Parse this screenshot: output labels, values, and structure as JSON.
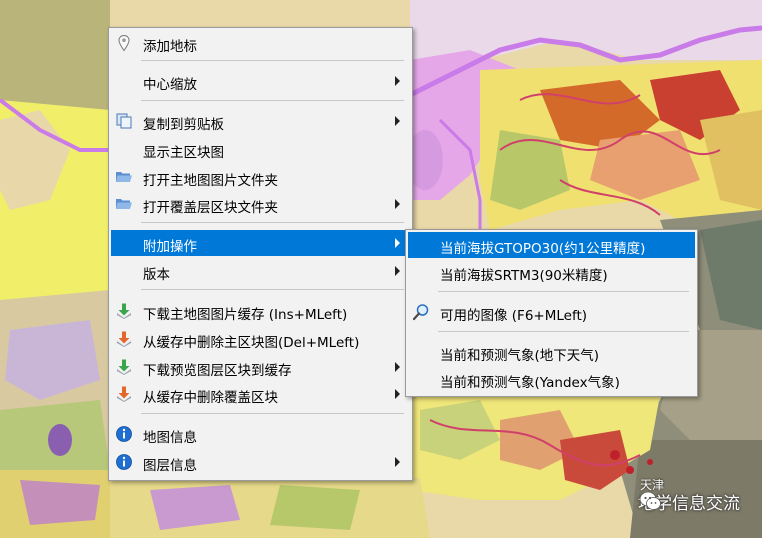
{
  "context_menu": {
    "items": [
      {
        "label": "添加地标",
        "icon": "map-pin-icon"
      },
      {
        "label": "中心缩放"
      },
      {
        "label": "复制到剪贴板",
        "icon": "copy-icon"
      },
      {
        "label": "显示主区块图"
      },
      {
        "label": "打开主地图图片文件夹",
        "icon": "folder-icon"
      },
      {
        "label": "打开覆盖层区块文件夹",
        "icon": "folder-icon"
      },
      {
        "label": "附加操作"
      },
      {
        "label": "版本"
      },
      {
        "label": "下载主地图图片缓存 (Ins+MLeft)",
        "icon": "download-icon"
      },
      {
        "label": "从缓存中删除主区块图(Del+MLeft)",
        "icon": "delete-cache-icon"
      },
      {
        "label": "下载预览图层区块到缓存",
        "icon": "download-icon"
      },
      {
        "label": "从缓存中删除覆盖区块",
        "icon": "delete-cache-icon"
      },
      {
        "label": "地图信息",
        "icon": "info-icon"
      },
      {
        "label": "图层信息",
        "icon": "info-icon"
      }
    ]
  },
  "submenu": {
    "items": [
      {
        "label": "当前海拔GTOPO30(约1公里精度)"
      },
      {
        "label": "当前海拔SRTM3(90米精度)"
      },
      {
        "label": "可用的图像 (F6+MLeft)",
        "icon": "magnifier-icon"
      },
      {
        "label": "当前和预测气象(地下天气)"
      },
      {
        "label": "当前和预测气象(Yandex气象)"
      }
    ]
  },
  "map": {
    "city_label": "天津",
    "watermark": "地学信息交流"
  },
  "colors": {
    "highlight": "#0078d7",
    "menu_bg": "#f2f2f2",
    "boundary": "#c97be8"
  }
}
